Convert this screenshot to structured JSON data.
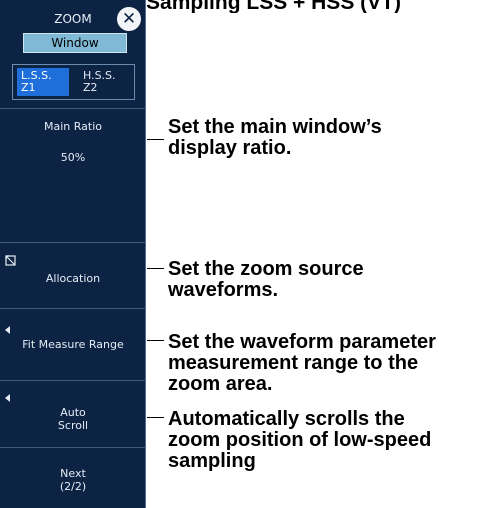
{
  "caption": "For Repeated Sampling LSS + HSS (VT)",
  "panel": {
    "title": "ZOOM",
    "window_button": "Window",
    "tabs": [
      {
        "line1": "L.S.S.",
        "line2": "Z1",
        "selected": true
      },
      {
        "line1": "H.S.S.",
        "line2": "Z2",
        "selected": false
      }
    ],
    "main_ratio_label": "Main Ratio",
    "main_ratio_value": "50%",
    "allocation_label": "Allocation",
    "fit_measure_label": "Fit Measure Range",
    "auto_scroll_line1": "Auto",
    "auto_scroll_line2": "Scroll",
    "next_line1": "Next",
    "next_line2": "(2/2)"
  },
  "callouts": {
    "main_ratio": "Set the main window’s\ndisplay ratio.",
    "allocation": "Set the zoom source\nwaveforms.",
    "fit_measure": "Set the waveform parameter\nmeasurement range to the\nzoom area.",
    "auto_scroll": "Automatically scrolls the\nzoom position of low-speed\nsampling"
  },
  "colors": {
    "panel_bg": "#0c2344",
    "selected_tab": "#1e6fd9",
    "window_button": "#7fb9d6"
  }
}
